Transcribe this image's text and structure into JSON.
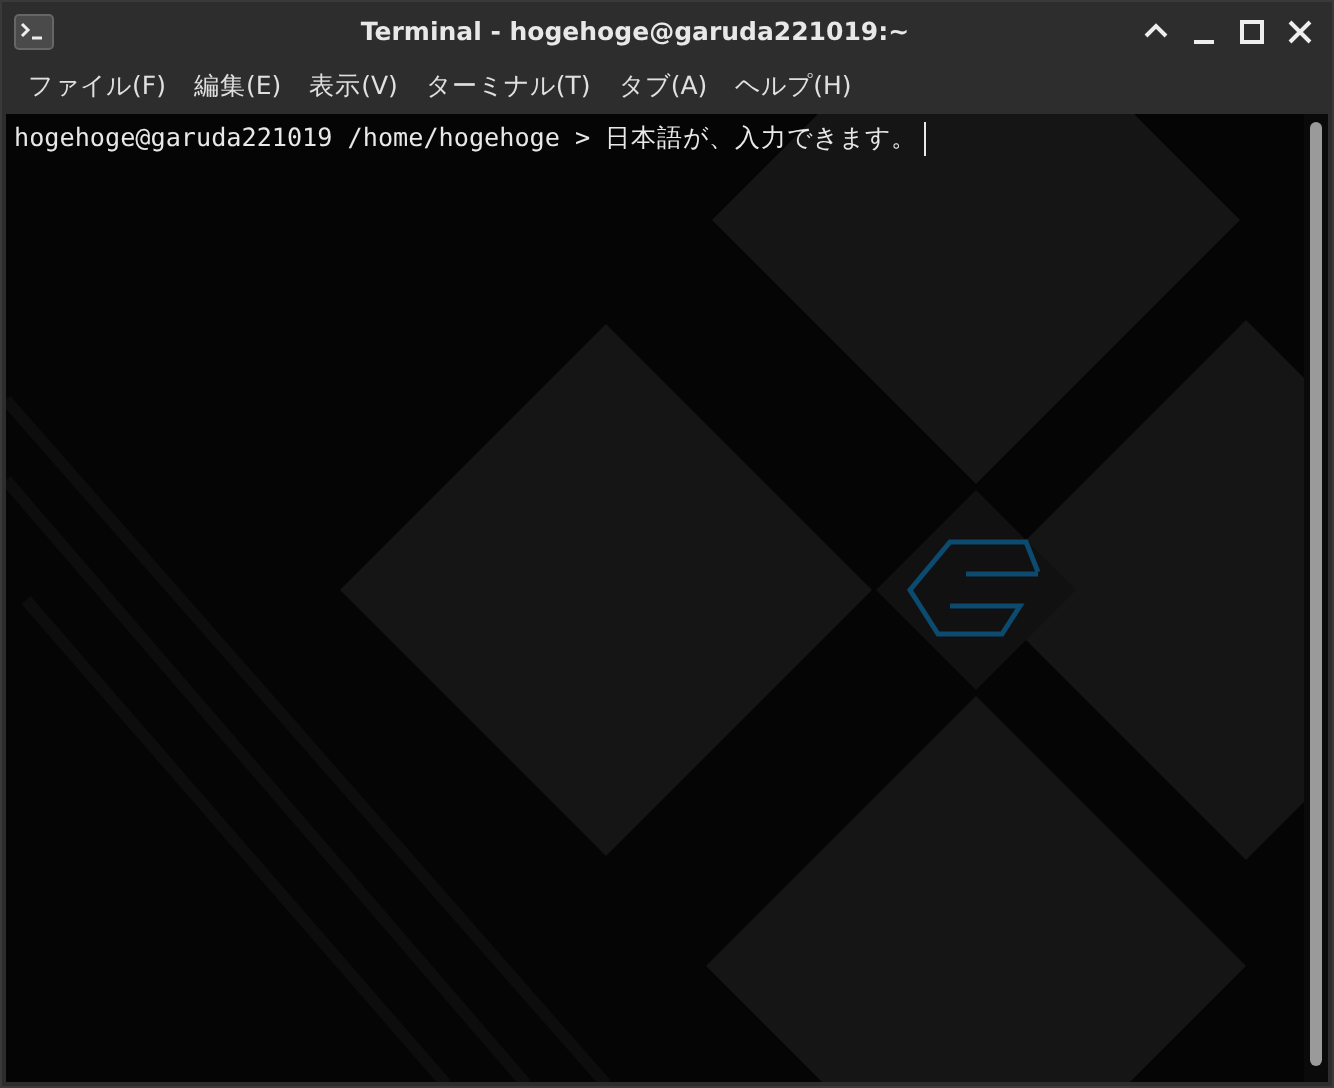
{
  "window": {
    "title": "Terminal - hogehoge@garuda221019:~"
  },
  "menu": [
    "ファイル(F)",
    "編集(E)",
    "表示(V)",
    "ターミナル(T)",
    "タブ(A)",
    "ヘルプ(H)"
  ],
  "terminal": {
    "lines": [
      {
        "prompt": "hogehoge@garuda221019 /home/hogehoge > ",
        "input": "日本語が、入力できます。"
      }
    ]
  }
}
